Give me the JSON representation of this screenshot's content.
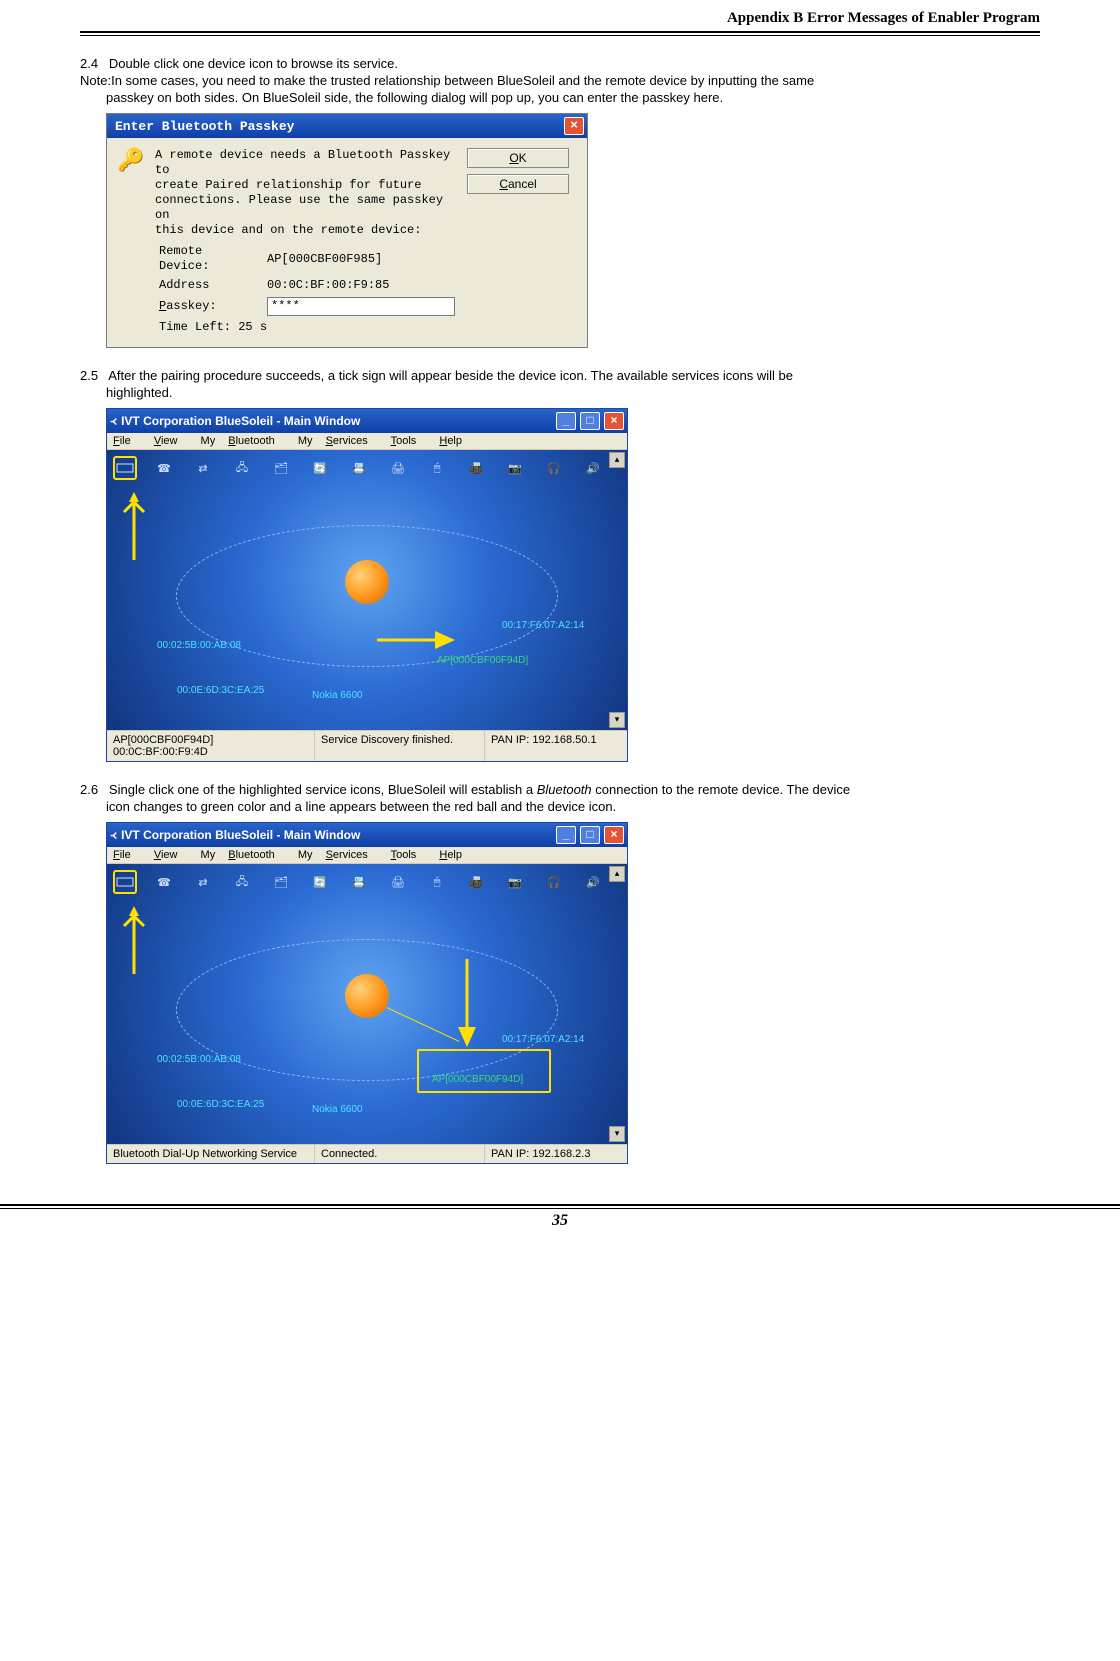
{
  "header": {
    "title": "Appendix B Error Messages of Enabler Program"
  },
  "step24": {
    "num": "2.4",
    "text": "Double click one device icon to browse its service.",
    "note_label": "Note:",
    "note_line1": "In some cases, you need to make the trusted relationship between BlueSoleil and the remote device by inputting the same",
    "note_line2": "passkey on both sides. On BlueSoleil side, the following dialog will pop up, you can enter the passkey here."
  },
  "passkey_dialog": {
    "title": "Enter Bluetooth Passkey",
    "msg_l1": "A remote device needs a Bluetooth Passkey to",
    "msg_l2": "create Paired relationship for future",
    "msg_l3": "connections. Please use the same passkey on",
    "msg_l4": "this device and on the remote device:",
    "remote_label": "Remote Device:",
    "remote_value": "AP[000CBF00F985]",
    "addr_label": "Address",
    "addr_value": "00:0C:BF:00:F9:85",
    "passkey_label_pre": "P",
    "passkey_label_post": "asskey:",
    "passkey_value": "****",
    "time_left": "Time Left: 25 s",
    "ok_pre": "O",
    "ok_post": "K",
    "cancel_pre": "C",
    "cancel_post": "ancel"
  },
  "step25": {
    "num": "2.5",
    "line1": "After the pairing procedure succeeds, a tick sign will appear beside the device icon. The available services icons will be",
    "line2": "highlighted."
  },
  "blueso_window": {
    "title": "IVT Corporation BlueSoleil - Main Window",
    "menu": {
      "file_u": "F",
      "file": "ile",
      "view_u": "V",
      "view": "iew",
      "mybt_pre": "My ",
      "mybt_u": "B",
      "mybt_post": "luetooth",
      "mysvc_pre": "My ",
      "mysvc_u": "S",
      "mysvc_post": "ervices",
      "tools_u": "T",
      "tools": "ools",
      "help_u": "H",
      "help": "elp"
    }
  },
  "win1": {
    "devices": {
      "phone1": "00:02:5B:00:AB:08",
      "phone2": "00:0E:6D:3C:EA:25",
      "nokia": "Nokia 6600",
      "ap": "AP[000CBF00F94D]",
      "pc": "00:17:F6:07:A2:14"
    },
    "status_l": "AP[000CBF00F94D] 00:0C:BF:00:F9:4D",
    "status_c": "Service Discovery finished.",
    "status_r": "PAN IP: 192.168.50.1"
  },
  "step26": {
    "num": "2.6",
    "line1_a": "Single click one of the highlighted service icons, BlueSoleil will establish a ",
    "line1_b": "Bluetooth",
    "line1_c": " connection to the remote device. The device",
    "line2": "icon changes to green color and a line appears between the red ball and the device icon."
  },
  "win2": {
    "devices": {
      "phone1": "00:02:5B:00:AB:08",
      "phone2": "00:0E:6D:3C:EA:25",
      "nokia": "Nokia 6600",
      "ap": "AP[000CBF00F94D]",
      "pc": "00:17:F6:07:A2:14"
    },
    "status_l": "Bluetooth Dial-Up Networking Service",
    "status_c": "Connected.",
    "status_r": "PAN IP: 192.168.2.3"
  },
  "page_number": "35"
}
